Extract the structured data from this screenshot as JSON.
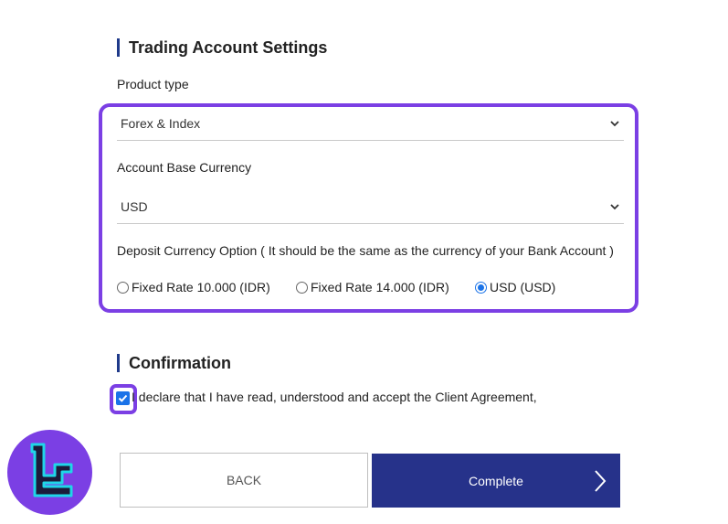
{
  "trading": {
    "title": "Trading Account Settings",
    "product_type_label": "Product type",
    "product_type_value": "Forex & Index",
    "base_currency_label": "Account Base Currency",
    "base_currency_value": "USD",
    "deposit_label": "Deposit Currency Option ( It should be the same as the currency of your Bank Account )",
    "deposit_options": [
      {
        "label": "Fixed Rate 10.000 (IDR)",
        "selected": false
      },
      {
        "label": "Fixed Rate 14.000 (IDR)",
        "selected": false
      },
      {
        "label": "USD (USD)",
        "selected": true
      }
    ]
  },
  "confirmation": {
    "title": "Confirmation",
    "agree_text": "I declare that I have read, understood and accept the Client Agreement,",
    "agree_checked": true
  },
  "buttons": {
    "back_label": "BACK",
    "complete_label": "Complete"
  },
  "colors": {
    "highlight": "#7b3fe4",
    "primary_button": "#26328a",
    "accent_blue": "#1a73e8"
  },
  "icons": {
    "select_chevron": "chevron-down-icon",
    "complete_arrow": "chevron-right-icon",
    "logo": "brand-logo-icon"
  }
}
